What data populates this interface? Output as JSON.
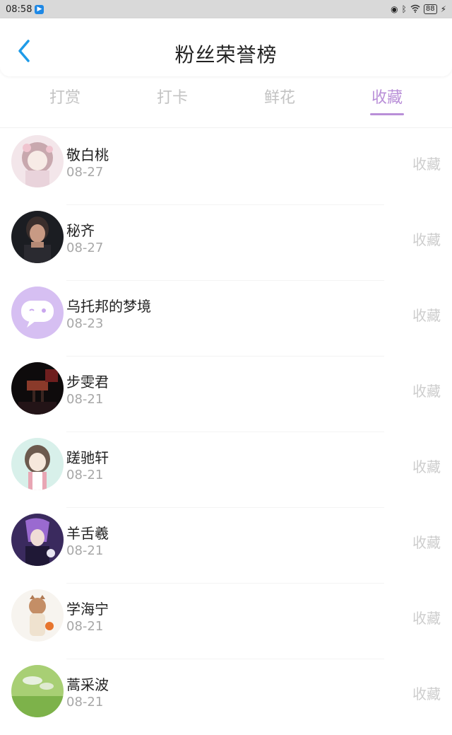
{
  "status_bar": {
    "time": "08:58",
    "battery": "88"
  },
  "header": {
    "title": "粉丝荣誉榜"
  },
  "tabs": [
    {
      "label": "打赏",
      "active": false
    },
    {
      "label": "打卡",
      "active": false
    },
    {
      "label": "鲜花",
      "active": false
    },
    {
      "label": "收藏",
      "active": true
    }
  ],
  "colors": {
    "accent": "#b98fd8",
    "back_arrow": "#1e9be8"
  },
  "list": [
    {
      "name": "敬白桃",
      "date": "08-27",
      "action": "收藏"
    },
    {
      "name": "秘齐",
      "date": "08-27",
      "action": "收藏"
    },
    {
      "name": "乌托邦的梦境",
      "date": "08-23",
      "action": "收藏"
    },
    {
      "name": "步雯君",
      "date": "08-21",
      "action": "收藏"
    },
    {
      "name": "蹉驰轩",
      "date": "08-21",
      "action": "收藏"
    },
    {
      "name": "羊舌羲",
      "date": "08-21",
      "action": "收藏"
    },
    {
      "name": "学海宁",
      "date": "08-21",
      "action": "收藏"
    },
    {
      "name": "蒿采波",
      "date": "08-21",
      "action": "收藏"
    }
  ]
}
